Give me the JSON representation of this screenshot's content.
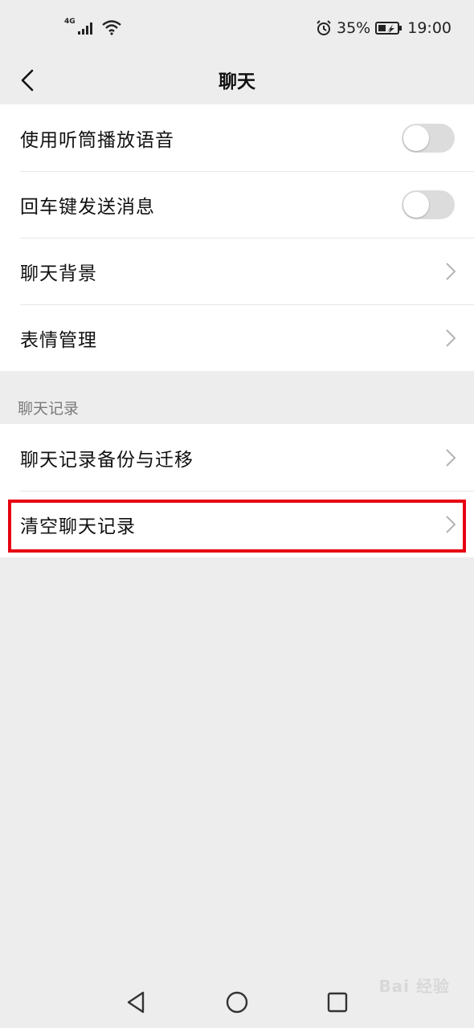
{
  "status_bar": {
    "network": "4G",
    "battery_percent": "35%",
    "time": "19:00",
    "icons": [
      "signal-icon",
      "wifi-icon",
      "alarm-icon",
      "battery-icon"
    ]
  },
  "nav": {
    "title": "聊天",
    "back_icon": "chevron-left-icon"
  },
  "settings_group_1": {
    "items": [
      {
        "label": "使用听筒播放语音",
        "control": "toggle",
        "on": false
      },
      {
        "label": "回车键发送消息",
        "control": "toggle",
        "on": false
      },
      {
        "label": "聊天背景",
        "control": "chevron"
      },
      {
        "label": "表情管理",
        "control": "chevron"
      }
    ]
  },
  "chat_history_section": {
    "header": "聊天记录",
    "items": [
      {
        "label": "聊天记录备份与迁移",
        "control": "chevron"
      },
      {
        "label": "清空聊天记录",
        "control": "chevron",
        "highlighted": true
      }
    ]
  },
  "colors": {
    "background": "#ededed",
    "card": "#ffffff",
    "highlight_border": "#e60012",
    "toggle_off": "#dcdcdc"
  },
  "system_nav": [
    "back-triangle-icon",
    "home-circle-icon",
    "recents-square-icon"
  ],
  "watermark": "Bai 经验"
}
